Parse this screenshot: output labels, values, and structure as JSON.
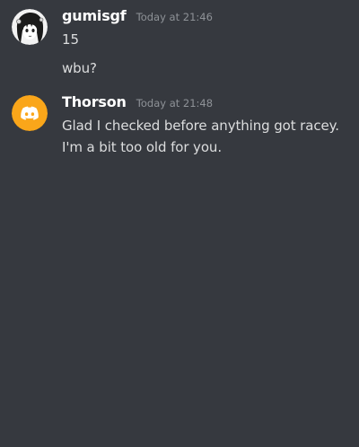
{
  "messages": [
    {
      "username": "gumisgf",
      "timestamp": "Today at 21:46",
      "avatar_icon": "anime-profile-avatar-icon",
      "lines": [
        "15",
        "wbu?"
      ]
    },
    {
      "username": "Thorson",
      "timestamp": "Today at 21:48",
      "avatar_icon": "discord-default-avatar-icon",
      "avatar_color": "#faa61a",
      "lines": [
        "Glad I checked before anything got racey. I'm a bit too old for you."
      ]
    }
  ],
  "colors": {
    "background": "#36393f",
    "username": "#ffffff",
    "timestamp": "#8e9297",
    "text": "#dcddde"
  }
}
